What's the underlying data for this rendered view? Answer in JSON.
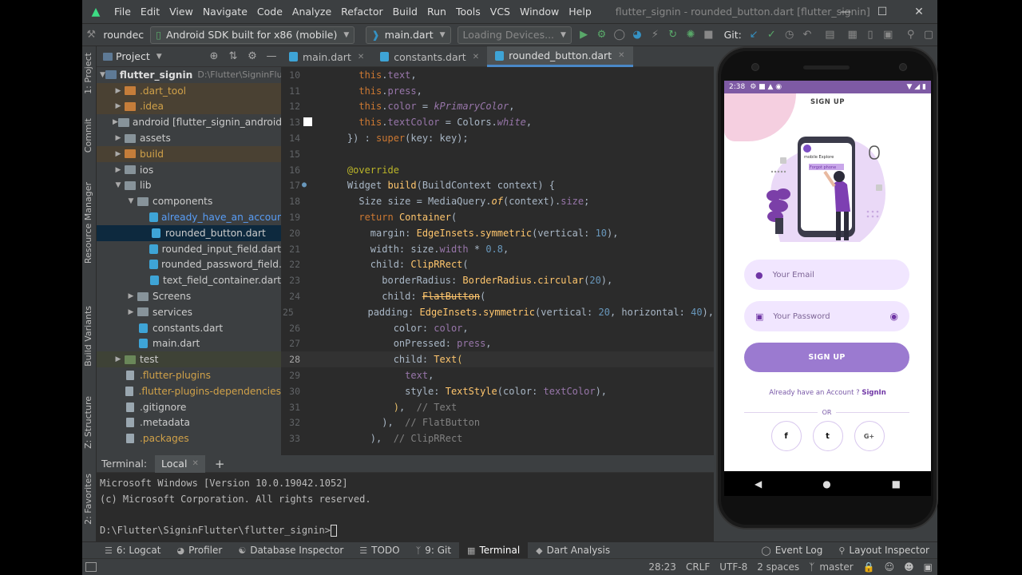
{
  "menu": {
    "items": [
      "File",
      "Edit",
      "View",
      "Navigate",
      "Code",
      "Analyze",
      "Refactor",
      "Build",
      "Run",
      "Tools",
      "VCS",
      "Window",
      "Help"
    ],
    "window_title": "flutter_signin - rounded_button.dart [flutter_signin]"
  },
  "toolbar": {
    "project_crumb": "roundec",
    "device": "Android SDK built for x86 (mobile)",
    "run_config": "main.dart",
    "device_loading": "Loading Devices...",
    "git_label": "Git:"
  },
  "left_tabs": [
    "1: Project",
    "Commit",
    "Resource Manager",
    "Build Variants",
    "Z: Structure",
    "2: Favorites"
  ],
  "project": {
    "header": "Project",
    "root_name": "flutter_signin",
    "root_path": "D:\\Flutter\\SigninFlutt",
    "rows": [
      {
        "label": "flutter_signin",
        "depth": 0
      },
      {
        "label": ".dart_tool",
        "depth": 1
      },
      {
        "label": ".idea",
        "depth": 1
      },
      {
        "label": "android [flutter_signin_android]",
        "depth": 1
      },
      {
        "label": "assets",
        "depth": 1
      },
      {
        "label": "build",
        "depth": 1
      },
      {
        "label": "ios",
        "depth": 1
      },
      {
        "label": "lib",
        "depth": 1
      },
      {
        "label": "components",
        "depth": 2
      },
      {
        "label": "already_have_an_account.dart",
        "depth": 3
      },
      {
        "label": "rounded_button.dart",
        "depth": 3
      },
      {
        "label": "rounded_input_field.dart",
        "depth": 3
      },
      {
        "label": "rounded_password_field.dart",
        "depth": 3
      },
      {
        "label": "text_field_container.dart",
        "depth": 3
      },
      {
        "label": "Screens",
        "depth": 2
      },
      {
        "label": "services",
        "depth": 2
      },
      {
        "label": "constants.dart",
        "depth": 2
      },
      {
        "label": "main.dart",
        "depth": 2
      },
      {
        "label": "test",
        "depth": 1
      },
      {
        "label": ".flutter-plugins",
        "depth": 1
      },
      {
        "label": ".flutter-plugins-dependencies",
        "depth": 1
      },
      {
        "label": ".gitignore",
        "depth": 1
      },
      {
        "label": ".metadata",
        "depth": 1
      },
      {
        "label": ".packages",
        "depth": 1
      }
    ]
  },
  "editor": {
    "tabs": [
      "main.dart",
      "constants.dart",
      "rounded_button.dart"
    ],
    "active_tab": "rounded_button.dart",
    "line_numbers": [
      "10",
      "11",
      "12",
      "13",
      "14",
      "15",
      "16",
      "17",
      "18",
      "19",
      "20",
      "21",
      "22",
      "23",
      "24",
      "25",
      "26",
      "27",
      "28",
      "29",
      "30",
      "31",
      "32",
      "33"
    ],
    "current_line": "28"
  },
  "terminal": {
    "label": "Terminal:",
    "tab": "Local",
    "lines": [
      "Microsoft Windows [Version 10.0.19042.1052]",
      "(c) Microsoft Corporation. All rights reserved.",
      "",
      "D:\\Flutter\\SigninFlutter\\flutter_signin>"
    ]
  },
  "bottom_tabs": {
    "left": [
      "6: Logcat",
      "Profiler",
      "Database Inspector",
      "TODO",
      "9: Git",
      "Terminal",
      "Dart Analysis"
    ],
    "active": "Terminal",
    "right": [
      "Event Log",
      "Layout Inspector"
    ]
  },
  "status": {
    "position": "28:23",
    "line_sep": "CRLF",
    "encoding": "UTF-8",
    "indent": "2 spaces",
    "branch": "master"
  },
  "phone": {
    "time": "2:38",
    "title": "SIGN UP",
    "email_placeholder": "Your Email",
    "password_placeholder": "Your Password",
    "button": "SIGN UP",
    "already": "Already have an Account ? ",
    "signin": "SignIn",
    "or": "OR",
    "socials": [
      "f",
      "t",
      "G+"
    ],
    "illus_text1": "mobile Explore",
    "illus_text2": "Forgot phone"
  },
  "colors": {
    "primary": "#6F35A5",
    "primary_light": "#F1E6FF",
    "accent_blue": "#4A88C7"
  }
}
